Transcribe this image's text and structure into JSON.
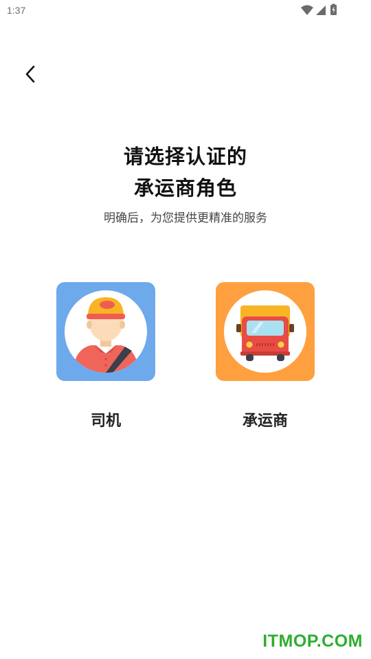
{
  "status_bar": {
    "time": "1:37",
    "icons": [
      "wifi-icon",
      "signal-icon",
      "battery-icon"
    ]
  },
  "header": {
    "back_icon": "chevron-left-icon"
  },
  "title": {
    "line1": "请选择认证的",
    "line2": "承运商角色",
    "subtitle": "明确后，为您提供更精准的服务"
  },
  "roles": [
    {
      "label": "司机",
      "icon": "driver-avatar-icon",
      "color": "#6ea9ec"
    },
    {
      "label": "承运商",
      "icon": "truck-icon",
      "color": "#ffa040"
    }
  ],
  "watermark": "ITMOP.COM"
}
